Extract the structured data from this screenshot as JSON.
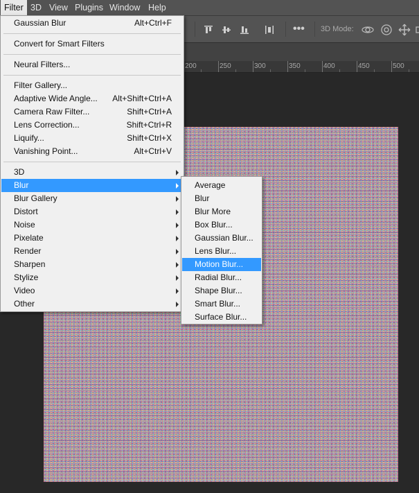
{
  "menubar": {
    "items": [
      {
        "label": "Filter",
        "active": true
      },
      {
        "label": "3D"
      },
      {
        "label": "View"
      },
      {
        "label": "Plugins"
      },
      {
        "label": "Window"
      },
      {
        "label": "Help"
      }
    ]
  },
  "options_bar": {
    "mode_label": "3D Mode:"
  },
  "ruler": {
    "labels": [
      "200",
      "250",
      "300",
      "350",
      "400",
      "450",
      "500"
    ]
  },
  "filter_menu": {
    "items": [
      {
        "label": "Gaussian Blur",
        "shortcut": "Alt+Ctrl+F"
      },
      {
        "label": "Convert for Smart Filters"
      },
      {
        "label": "Neural Filters..."
      },
      {
        "label": "Filter Gallery..."
      },
      {
        "label": "Adaptive Wide Angle...",
        "shortcut": "Alt+Shift+Ctrl+A"
      },
      {
        "label": "Camera Raw Filter...",
        "shortcut": "Shift+Ctrl+A"
      },
      {
        "label": "Lens Correction...",
        "shortcut": "Shift+Ctrl+R"
      },
      {
        "label": "Liquify...",
        "shortcut": "Shift+Ctrl+X"
      },
      {
        "label": "Vanishing Point...",
        "shortcut": "Alt+Ctrl+V"
      },
      {
        "label": "3D",
        "submenu": true
      },
      {
        "label": "Blur",
        "submenu": true,
        "highlighted": true
      },
      {
        "label": "Blur Gallery",
        "submenu": true
      },
      {
        "label": "Distort",
        "submenu": true
      },
      {
        "label": "Noise",
        "submenu": true
      },
      {
        "label": "Pixelate",
        "submenu": true
      },
      {
        "label": "Render",
        "submenu": true
      },
      {
        "label": "Sharpen",
        "submenu": true
      },
      {
        "label": "Stylize",
        "submenu": true
      },
      {
        "label": "Video",
        "submenu": true
      },
      {
        "label": "Other",
        "submenu": true
      }
    ]
  },
  "blur_submenu": {
    "items": [
      {
        "label": "Average"
      },
      {
        "label": "Blur"
      },
      {
        "label": "Blur More"
      },
      {
        "label": "Box Blur..."
      },
      {
        "label": "Gaussian Blur..."
      },
      {
        "label": "Lens Blur..."
      },
      {
        "label": "Motion Blur...",
        "highlighted": true
      },
      {
        "label": "Radial Blur..."
      },
      {
        "label": "Shape Blur..."
      },
      {
        "label": "Smart Blur..."
      },
      {
        "label": "Surface Blur..."
      }
    ]
  },
  "colors": {
    "highlight": "#3399ff",
    "menu_bg": "#f0f0f0",
    "menubar_bg": "#535353",
    "workspace_bg": "#282828"
  },
  "icons": [
    "align-top-icon",
    "align-vertical-center-icon",
    "align-bottom-icon",
    "distribute-icon",
    "more-options-icon",
    "orbit-3d-icon",
    "roll-3d-icon",
    "pan-3d-icon"
  ]
}
